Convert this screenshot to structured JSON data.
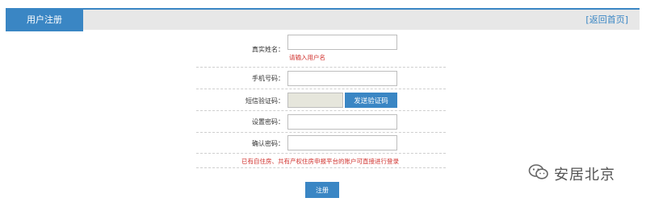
{
  "header": {
    "tab_title": "用户注册",
    "back_link": "[返回首页]"
  },
  "form": {
    "real_name": {
      "label": "真实姓名：",
      "value": "",
      "error": "请输入用户名"
    },
    "phone": {
      "label": "手机号码：",
      "value": ""
    },
    "sms_code": {
      "label": "短信验证码：",
      "value": "",
      "send_button": "发送验证码"
    },
    "password": {
      "label": "设置密码：",
      "value": ""
    },
    "confirm_password": {
      "label": "确认密码：",
      "value": ""
    },
    "notice": "已有自住房、共有产权住房申报平台的账户可直接进行登录",
    "submit_label": "注册"
  },
  "watermark": {
    "text": "安居北京",
    "icon": "wechat-icon"
  },
  "colors": {
    "accent": "#3a86c4",
    "error": "#d0312d",
    "header_bg": "#e7e7e7"
  }
}
